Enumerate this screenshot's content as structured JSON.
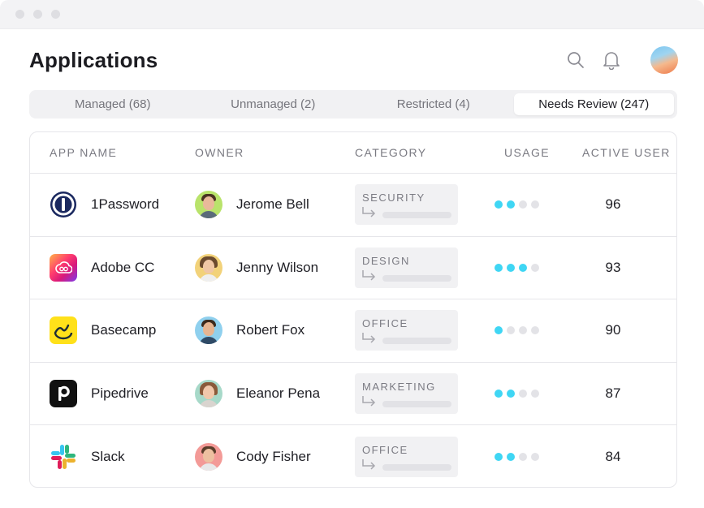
{
  "header": {
    "title": "Applications"
  },
  "tabs": [
    {
      "label": "Managed (68)",
      "active": false
    },
    {
      "label": "Unmanaged (2)",
      "active": false
    },
    {
      "label": "Restricted (4)",
      "active": false
    },
    {
      "label": "Needs Review (247)",
      "active": true
    }
  ],
  "table": {
    "columns": [
      "APP NAME",
      "OWNER",
      "CATEGORY",
      "USAGE",
      "ACTIVE USER"
    ],
    "rows": [
      {
        "app": "1Password",
        "icon": "1password-logo-icon",
        "owner": "Jerome Bell",
        "category": "SECURITY",
        "usage": 2,
        "active": "96"
      },
      {
        "app": "Adobe CC",
        "icon": "adobe-cc-logo-icon",
        "owner": "Jenny Wilson",
        "category": "DESIGN",
        "usage": 3,
        "active": "93"
      },
      {
        "app": "Basecamp",
        "icon": "basecamp-logo-icon",
        "owner": "Robert Fox",
        "category": "OFFICE",
        "usage": 1,
        "active": "90"
      },
      {
        "app": "Pipedrive",
        "icon": "pipedrive-logo-icon",
        "owner": "Eleanor Pena",
        "category": "MARKETING",
        "usage": 2,
        "active": "87"
      },
      {
        "app": "Slack",
        "icon": "slack-logo-icon",
        "owner": "Cody Fisher",
        "category": "OFFICE",
        "usage": 2,
        "active": "84"
      }
    ],
    "usage_max": 4
  },
  "colors": {
    "usage_on": "#3fd6f4",
    "usage_off": "#e3e3e7",
    "accent_avatar": "#ee7a4a"
  }
}
